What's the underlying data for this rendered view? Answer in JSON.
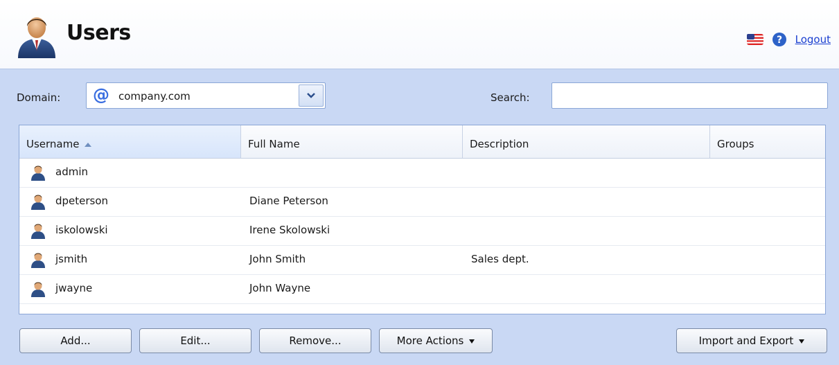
{
  "header": {
    "title": "Users",
    "logout_label": "Logout",
    "icons": [
      "users-avatar-icon",
      "us-flag-icon",
      "help-icon"
    ]
  },
  "filters": {
    "domain_label": "Domain:",
    "domain_value": "company.com",
    "search_label": "Search:",
    "search_value": ""
  },
  "table": {
    "columns": [
      "Username",
      "Full Name",
      "Description",
      "Groups"
    ],
    "sorted_column": "Username",
    "sort_direction": "ascending",
    "rows": [
      {
        "username": "admin",
        "full_name": "",
        "description": "",
        "groups": ""
      },
      {
        "username": "dpeterson",
        "full_name": "Diane Peterson",
        "description": "",
        "groups": ""
      },
      {
        "username": "iskolowski",
        "full_name": "Irene Skolowski",
        "description": "",
        "groups": ""
      },
      {
        "username": "jsmith",
        "full_name": "John Smith",
        "description": "Sales dept.",
        "groups": ""
      },
      {
        "username": "jwayne",
        "full_name": "John Wayne",
        "description": "",
        "groups": ""
      }
    ]
  },
  "actions": {
    "add": "Add...",
    "edit": "Edit...",
    "remove": "Remove...",
    "more_actions": "More Actions",
    "import_export": "Import and Export"
  },
  "colors": {
    "background": "#c9d8f4",
    "link": "#1a3fd0",
    "border": "#8aa6d6"
  }
}
